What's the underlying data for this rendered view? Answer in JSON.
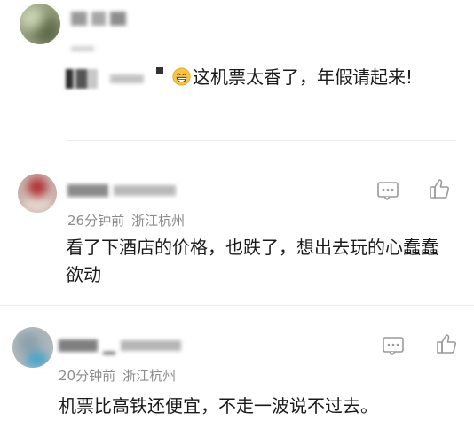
{
  "comments": [
    {
      "text_before": "这机票太香了，年假请起来!",
      "emoji": "grinning-face-emoji"
    },
    {
      "time": "26分钟前",
      "location": "浙江杭州",
      "text": "看了下酒店的价格，也跌了，想出去玩的心蠢蠢欲动",
      "icons": [
        "comment-icon",
        "like-icon"
      ]
    },
    {
      "time": "20分钟前",
      "location": "浙江杭州",
      "text": "机票比高铁还便宜，不走一波说不过去。",
      "icons": [
        "comment-icon",
        "like-icon"
      ]
    }
  ],
  "colors": {
    "meta": "#8c8c8c",
    "body": "#1a1a1a",
    "divider": "#ebebeb",
    "icon": "#9a9a9a"
  }
}
